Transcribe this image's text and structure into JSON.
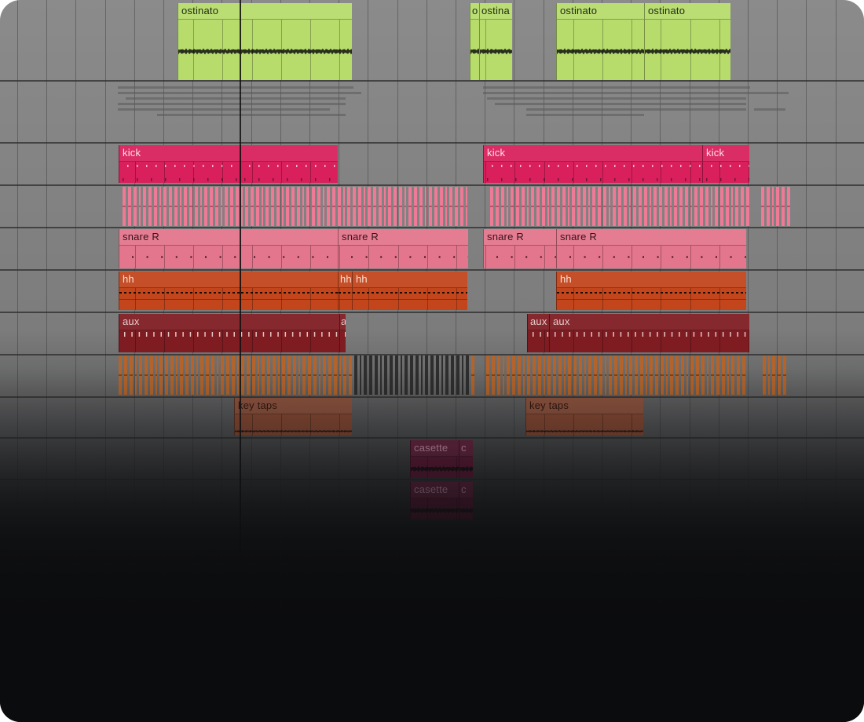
{
  "colors": {
    "ostinato": "#b7dc6c",
    "kick": "#d9205c",
    "snare": "#e3758c",
    "hh": "#c2451c",
    "aux": "#7f1c22",
    "perc": "#b4642a",
    "keytaps": "#8a4a33",
    "casette": "#6e1a3c",
    "playhead": "#111111"
  },
  "tracks": [
    {
      "id": "ostinato",
      "clips": [
        {
          "label": "ostinato",
          "style": "audio"
        },
        {
          "label": "",
          "style": "audio"
        },
        {
          "label": "o",
          "style": "audio"
        },
        {
          "label": "ostina",
          "style": "audio"
        },
        {
          "label": "ostinato",
          "style": "audio"
        },
        {
          "label": "ostinato",
          "style": "audio"
        }
      ]
    },
    {
      "id": "kick",
      "clips": [
        {
          "label": "kick",
          "style": "midi"
        },
        {
          "label": "",
          "style": "midi"
        },
        {
          "label": "kick",
          "style": "midi"
        },
        {
          "label": "kick",
          "style": "midi"
        }
      ]
    },
    {
      "id": "snare",
      "clips": [
        {
          "label": "snare R",
          "style": "midi"
        },
        {
          "label": "",
          "style": "midi"
        },
        {
          "label": "snare R",
          "style": "midi"
        },
        {
          "label": "snare R",
          "style": "midi"
        },
        {
          "label": "snare R",
          "style": "midi"
        }
      ]
    },
    {
      "id": "hh",
      "clips": [
        {
          "label": "hh",
          "style": "midi"
        },
        {
          "label": "",
          "style": "midi"
        },
        {
          "label": "hh",
          "style": "midi"
        },
        {
          "label": "hh",
          "style": "midi"
        },
        {
          "label": "hh",
          "style": "midi"
        }
      ]
    },
    {
      "id": "aux",
      "clips": [
        {
          "label": "aux",
          "style": "midi"
        },
        {
          "label": "a",
          "style": "midi"
        },
        {
          "label": "aux",
          "style": "midi"
        },
        {
          "label": "aux",
          "style": "midi"
        }
      ]
    },
    {
      "id": "keytaps",
      "clips": [
        {
          "label": "key taps",
          "style": "audio"
        },
        {
          "label": "key taps",
          "style": "audio"
        }
      ]
    },
    {
      "id": "casette",
      "clips": [
        {
          "label": "casette",
          "style": "audio"
        },
        {
          "label": "c",
          "style": "audio"
        },
        {
          "label": "casette",
          "style": "audio"
        },
        {
          "label": "c",
          "style": "audio"
        }
      ]
    }
  ]
}
